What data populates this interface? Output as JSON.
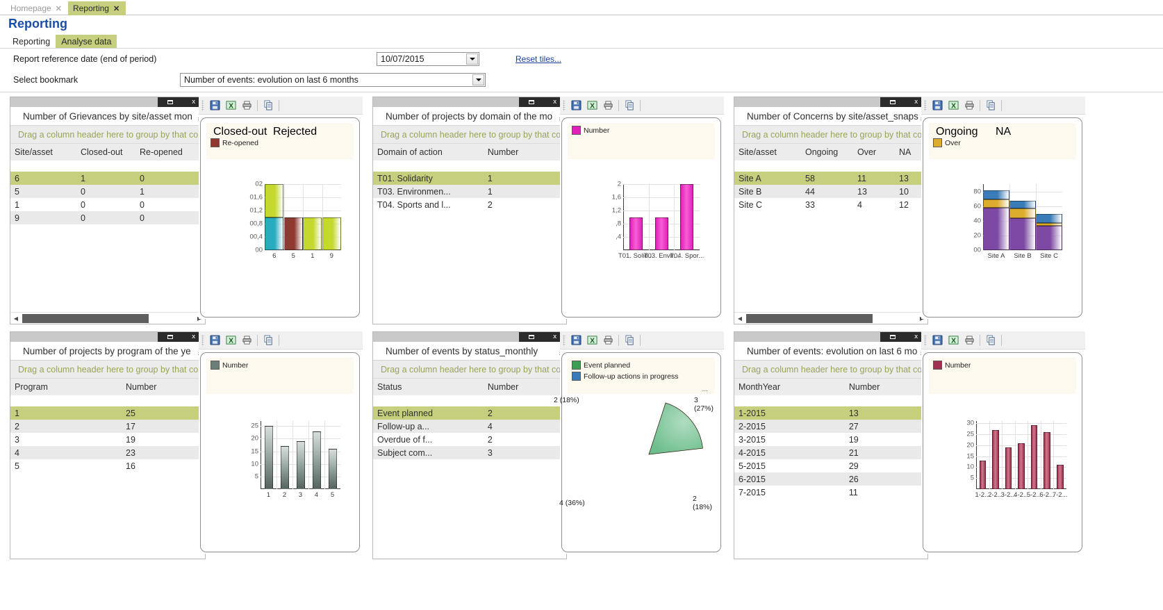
{
  "tabs": [
    {
      "label": "Homepage",
      "close": "✕",
      "active": false
    },
    {
      "label": "Reporting",
      "close": "✕",
      "active": true
    }
  ],
  "header": {
    "title": "Reporting"
  },
  "subtabs": [
    {
      "label": "Reporting",
      "active": false
    },
    {
      "label": "Analyse data",
      "active": true
    }
  ],
  "filters": {
    "date_label": "Report reference date (end of period)",
    "date_value": "10/07/2015",
    "bookmark_label": "Select bookmark",
    "bookmark_value": "Number of events: evolution on last 6 months",
    "reset_link": "Reset tiles..."
  },
  "common": {
    "group_hint": "Drag a column header here to group by that co",
    "chevron": "»",
    "close_glyph": "x",
    "scroll_left": "◀",
    "scroll_right": "▶",
    "toolbar_icons": [
      "save-icon",
      "excel-export-icon",
      "print-icon",
      "copy-icon"
    ]
  },
  "tiles": [
    {
      "id": "grievances",
      "title": "Number of Grievances by site/asset mon",
      "columns": [
        "Site/asset",
        "Closed-out",
        "Re-opened"
      ],
      "rows": [
        [
          "6",
          "1",
          "0"
        ],
        [
          "5",
          "0",
          "1"
        ],
        [
          "1",
          "0",
          "0"
        ],
        [
          "9",
          "0",
          "0"
        ]
      ],
      "has_hscroll": true,
      "chart_data": {
        "type": "bar",
        "stacked": true,
        "title": "",
        "xlabel": "",
        "ylabel": "",
        "categories": [
          "6",
          "5",
          "1",
          "9"
        ],
        "ylim": [
          0,
          2
        ],
        "yticks": [
          "00",
          "00,4",
          "00,8",
          "01,2",
          "01,6",
          "02"
        ],
        "series": [
          {
            "name": "Closed-out",
            "color": "#2aacc0",
            "values": [
              1,
              0,
              0,
              0
            ]
          },
          {
            "name": "Re-opened",
            "color": "#8e3a31",
            "values": [
              0,
              1,
              0,
              0
            ]
          },
          {
            "name": "Rejected",
            "color": "#c4d82e",
            "values": [
              1,
              0,
              1,
              1
            ]
          }
        ],
        "legend": [
          "Closed-out",
          "Rejected",
          "Re-opened"
        ]
      }
    },
    {
      "id": "projects-domain",
      "title": "Number of projects by domain of the mo",
      "columns": [
        "Domain of action",
        "Number"
      ],
      "rows": [
        [
          "T01. Solidarity",
          "1"
        ],
        [
          "T03.  Environmen...",
          "1"
        ],
        [
          "T04. Sports and l...",
          "2"
        ]
      ],
      "has_hscroll": false,
      "chart_data": {
        "type": "bar",
        "stacked": false,
        "title": "",
        "xlabel": "",
        "ylabel": "",
        "categories": [
          "T01. Solid...",
          "T03. Envir...",
          "T04. Spor..."
        ],
        "values": [
          1,
          1,
          2
        ],
        "ylim": [
          0,
          2
        ],
        "yticks": [
          "",
          ",4",
          ",8",
          "1,2",
          "1,6",
          "2"
        ],
        "series": [
          {
            "name": "Number",
            "color": "#e020b8",
            "values": [
              1,
              1,
              2
            ]
          }
        ],
        "legend": [
          "Number"
        ]
      }
    },
    {
      "id": "concerns",
      "title": "Number of Concerns by site/asset_snaps",
      "columns": [
        "Site/asset",
        "Ongoing",
        "Over",
        "NA"
      ],
      "rows": [
        [
          "Site A",
          "58",
          "11",
          "13"
        ],
        [
          "Site B",
          "44",
          "13",
          "10"
        ],
        [
          "Site C",
          "33",
          "4",
          "12"
        ]
      ],
      "has_hscroll": true,
      "chart_data": {
        "type": "bar",
        "stacked": true,
        "title": "",
        "xlabel": "",
        "ylabel": "",
        "categories": [
          "Site A",
          "Site B",
          "Site C"
        ],
        "ylim": [
          0,
          90
        ],
        "yticks": [
          "00",
          "20",
          "40",
          "60",
          "80"
        ],
        "series": [
          {
            "name": "Ongoing",
            "color": "#7d49a4",
            "values": [
              58,
              44,
              33
            ]
          },
          {
            "name": "Over",
            "color": "#dcac2e",
            "values": [
              11,
              13,
              4
            ]
          },
          {
            "name": "NA",
            "color": "#3a7cb8",
            "values": [
              13,
              10,
              12
            ]
          }
        ],
        "legend": [
          "Ongoing",
          "NA",
          "Over"
        ]
      }
    },
    {
      "id": "projects-program",
      "title": "Number of projects by program of the ye",
      "columns": [
        "Program",
        "Number"
      ],
      "rows": [
        [
          "1",
          "25"
        ],
        [
          "2",
          "17"
        ],
        [
          "3",
          "19"
        ],
        [
          "4",
          "23"
        ],
        [
          "5",
          "16"
        ]
      ],
      "has_hscroll": false,
      "chart_data": {
        "type": "bar",
        "stacked": false,
        "title": "",
        "xlabel": "",
        "ylabel": "",
        "categories": [
          "1",
          "2",
          "3",
          "4",
          "5"
        ],
        "values": [
          25,
          17,
          19,
          23,
          16
        ],
        "ylim": [
          0,
          27
        ],
        "yticks": [
          "5",
          "10",
          "15",
          "20",
          "25"
        ],
        "series": [
          {
            "name": "Number",
            "color": "#6d7d78",
            "values": [
              25,
              17,
              19,
              23,
              16
            ]
          }
        ],
        "legend": [
          "Number"
        ]
      }
    },
    {
      "id": "events-status",
      "title": "Number of events by status_monthly",
      "columns": [
        "Status",
        "Number"
      ],
      "rows": [
        [
          "Event planned",
          "2"
        ],
        [
          "Follow-up a...",
          "4"
        ],
        [
          "Overdue of f...",
          "2"
        ],
        [
          "Subject com...",
          "3"
        ]
      ],
      "has_hscroll": false,
      "chart_data": {
        "type": "pie",
        "title": "",
        "labels": [
          "Event planned",
          "Follow-up actions in progress",
          "Overdue of f...",
          "Subject com..."
        ],
        "values": [
          2,
          4,
          2,
          3
        ],
        "slice_labels": [
          "2 (18%)",
          "4 (36%)",
          "2 (18%)",
          "3 (27%)"
        ],
        "colors": [
          "#6fbf8e",
          "#3a7cb8",
          "#c1944f",
          "#c9a87a"
        ],
        "legend": [
          "Event planned",
          "Follow-up actions in progress",
          "..."
        ]
      }
    },
    {
      "id": "events-evolution",
      "title": "Number of events: evolution on last 6 mo",
      "columns": [
        "MonthYear",
        "Number"
      ],
      "rows": [
        [
          "1-2015",
          "13"
        ],
        [
          "2-2015",
          "27"
        ],
        [
          "3-2015",
          "19"
        ],
        [
          "4-2015",
          "21"
        ],
        [
          "5-2015",
          "29"
        ],
        [
          "6-2015",
          "26"
        ],
        [
          "7-2015",
          "11"
        ]
      ],
      "has_hscroll": false,
      "chart_data": {
        "type": "bar",
        "stacked": false,
        "title": "",
        "xlabel": "",
        "ylabel": "",
        "categories": [
          "1-2...",
          "2-2...",
          "3-2...",
          "4-2...",
          "5-2...",
          "6-2...",
          "7-2..."
        ],
        "values": [
          13,
          27,
          19,
          21,
          29,
          26,
          11
        ],
        "ylim": [
          0,
          31
        ],
        "yticks": [
          "5",
          "10",
          "15",
          "20",
          "25",
          "30"
        ],
        "series": [
          {
            "name": "Number",
            "color": "#9e3250",
            "values": [
              13,
              27,
              19,
              21,
              29,
              26,
              11
            ]
          }
        ],
        "legend": [
          "Number"
        ]
      }
    }
  ]
}
